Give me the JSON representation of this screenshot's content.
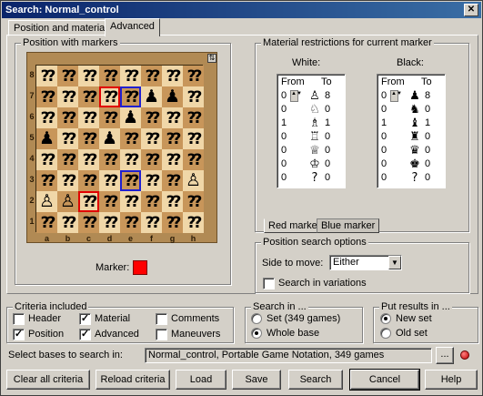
{
  "window": {
    "title": "Search: Normal_control"
  },
  "tabs": [
    "Position and material",
    "Advanced"
  ],
  "position_group": {
    "legend": "Position with markers",
    "ranks": [
      "8",
      "7",
      "6",
      "5",
      "4",
      "3",
      "2",
      "1"
    ],
    "files": [
      "a",
      "b",
      "c",
      "d",
      "e",
      "f",
      "g",
      "h"
    ],
    "board": [
      [
        "?",
        "?",
        "?",
        "?",
        "?",
        "?",
        "?",
        "?"
      ],
      [
        "?",
        "?",
        "?",
        "?",
        "?",
        "♟",
        "♟",
        "?"
      ],
      [
        "?",
        "?",
        "?",
        "?",
        "♟",
        "?",
        "?",
        "?"
      ],
      [
        "♟",
        "?",
        "?",
        "♟",
        "?",
        "?",
        "?",
        "?"
      ],
      [
        "?",
        "?",
        "?",
        "?",
        "?",
        "?",
        "?",
        "?"
      ],
      [
        "?",
        "?",
        "?",
        "?",
        "?",
        "?",
        "?",
        "♙"
      ],
      [
        "♙",
        "♙",
        "?",
        "?",
        "?",
        "?",
        "?",
        "?"
      ],
      [
        "?",
        "?",
        "?",
        "?",
        "?",
        "?",
        "?",
        "?"
      ]
    ],
    "red_marker_square": "d7",
    "red_marker_square_2": "c2",
    "blue_marker_square": "e7",
    "blue_marker_square_2": "e3",
    "marker_label": "Marker:",
    "marker_color": "#ff0000"
  },
  "material_group": {
    "legend": "Material restrictions for current marker",
    "white_label": "White:",
    "black_label": "Black:",
    "from_label": "From",
    "to_label": "To",
    "white_rows": [
      {
        "from": "0",
        "piece": "♙",
        "to": "8"
      },
      {
        "from": "0",
        "piece": "♘",
        "to": "0"
      },
      {
        "from": "1",
        "piece": "♗",
        "to": "1"
      },
      {
        "from": "0",
        "piece": "♖",
        "to": "0"
      },
      {
        "from": "0",
        "piece": "♕",
        "to": "0"
      },
      {
        "from": "0",
        "piece": "♔",
        "to": "0"
      },
      {
        "from": "0",
        "piece": "?",
        "to": "0"
      }
    ],
    "black_rows": [
      {
        "from": "0",
        "piece": "♟",
        "to": "8"
      },
      {
        "from": "0",
        "piece": "♞",
        "to": "0"
      },
      {
        "from": "1",
        "piece": "♝",
        "to": "1"
      },
      {
        "from": "0",
        "piece": "♜",
        "to": "0"
      },
      {
        "from": "0",
        "piece": "♛",
        "to": "0"
      },
      {
        "from": "0",
        "piece": "♚",
        "to": "0"
      },
      {
        "from": "0",
        "piece": "?",
        "to": "0"
      }
    ],
    "marker_tabs": [
      "Red marker",
      "Blue marker"
    ]
  },
  "options_group": {
    "legend": "Position search options",
    "side_label": "Side to move:",
    "side_value": "Either",
    "variations_label": "Search in variations"
  },
  "criteria_group": {
    "legend": "Criteria included",
    "items": [
      {
        "label": "Header",
        "checked": ""
      },
      {
        "label": "Material",
        "checked": "✓"
      },
      {
        "label": "Comments",
        "checked": ""
      },
      {
        "label": "Position",
        "checked": "✓"
      },
      {
        "label": "Advanced",
        "checked": "✓"
      },
      {
        "label": "Maneuvers",
        "checked": ""
      }
    ]
  },
  "search_in_group": {
    "legend": "Search in ...",
    "set_label": "Set  (349 games)",
    "whole_label": "Whole base"
  },
  "results_group": {
    "legend": "Put results in ...",
    "new_label": "New set",
    "old_label": "Old set"
  },
  "bases": {
    "label": "Select bases to search in:",
    "value": "Normal_control, Portable Game Notation, 349 games",
    "browse": "..."
  },
  "buttons": {
    "clear": "Clear all criteria",
    "reload": "Reload criteria",
    "load": "Load",
    "save": "Save",
    "search": "Search",
    "cancel": "Cancel",
    "help": "Help"
  }
}
